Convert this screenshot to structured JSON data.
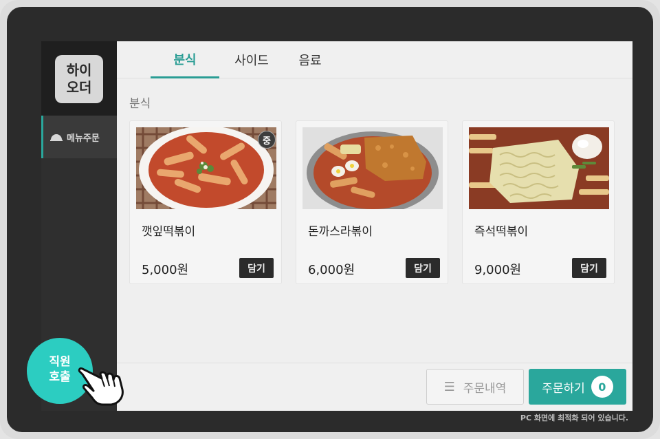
{
  "sidebar": {
    "logo_line1": "하이",
    "logo_line2": "오더",
    "nav_items": [
      {
        "label": "메뉴주문",
        "icon": "cloche-icon"
      }
    ]
  },
  "tabs": [
    {
      "label": "분식",
      "active": true
    },
    {
      "label": "사이드"
    },
    {
      "label": "음료"
    }
  ],
  "section_title": "분식",
  "menu_items": [
    {
      "name": "깻잎떡볶이",
      "price": "5,000원",
      "add_label": "담기",
      "badge": "중"
    },
    {
      "name": "돈까스라볶이",
      "price": "6,000원",
      "add_label": "담기"
    },
    {
      "name": "즉석떡볶이",
      "price": "9,000원",
      "add_label": "담기"
    }
  ],
  "footer": {
    "history_label": "주문내역",
    "order_label": "주문하기",
    "cart_count": "0"
  },
  "staff_call": {
    "line1": "직원",
    "line2": "호출"
  },
  "optimized_note": "PC 화면에 최적화 되어 있습니다.",
  "colors": {
    "accent": "#2aa79c",
    "call_button": "#2ccdc1",
    "device": "#2b2b2b"
  }
}
